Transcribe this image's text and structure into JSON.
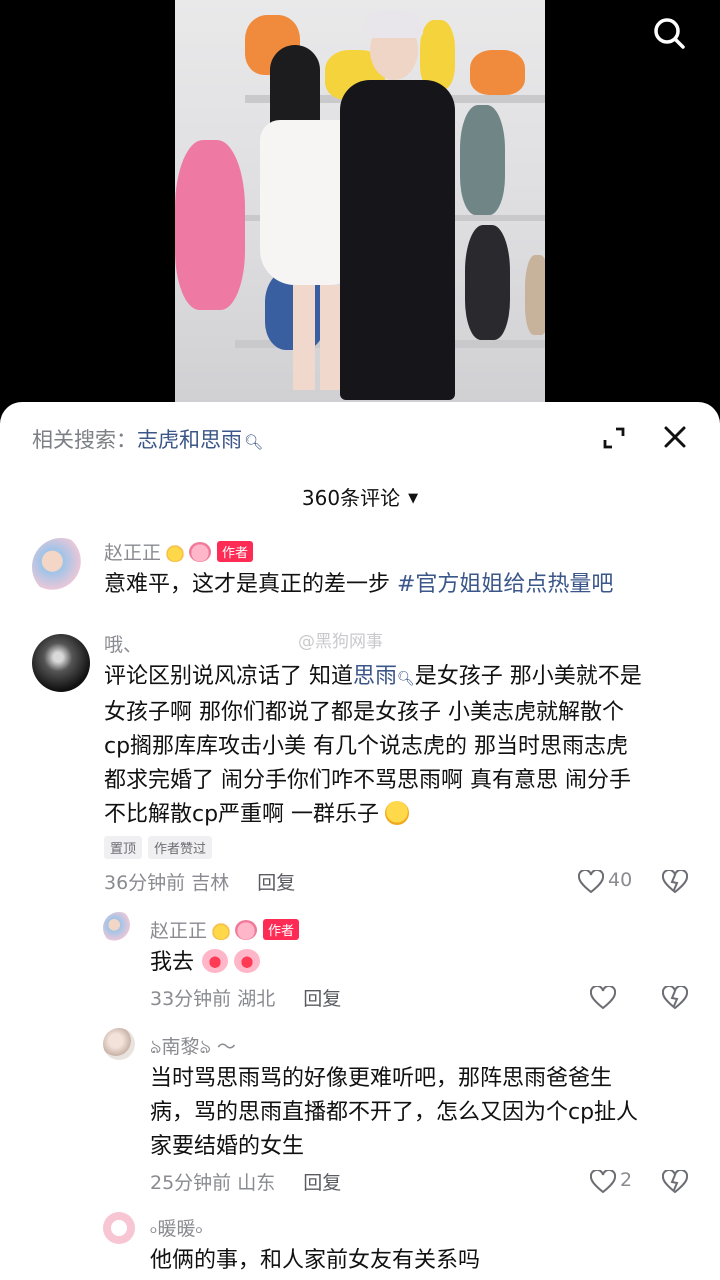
{
  "related_search": {
    "prefix": "相关搜索：",
    "term": "志虎和思雨"
  },
  "comments_count": "360条评论",
  "watermark": "@黑狗网事",
  "comments": [
    {
      "user": "赵正正",
      "badge": "作者",
      "text_a": "意难平，这才是真正的差一步 ",
      "hashtag": "#官方姐姐给点热量吧"
    },
    {
      "user": "哦、",
      "text_prefix": "评论区别说风凉话了 知道",
      "link": "思雨",
      "text_rest1": "是女孩子 那小美就不是",
      "line2": "女孩子啊 那你们都说了都是女孩子 小美志虎就解散个",
      "line3": "cp搁那库库攻击小美 有几个说志虎的 那当时思雨志虎",
      "line4": "都求完婚了 闹分手你们咋不骂思雨啊 真有意思 闹分手",
      "line5": "不比解散cp严重啊 一群乐子",
      "tags": [
        "置顶",
        "作者赞过"
      ],
      "time": "36分钟前 吉林",
      "reply": "回复",
      "likes": "40"
    },
    {
      "user": "赵正正",
      "badge": "作者",
      "text": "我去",
      "time": "33分钟前 湖北",
      "reply": "回复"
    },
    {
      "user": "ঌ南黎ঌ ～",
      "line1": "当时骂思雨骂的好像更难听吧，那阵思雨爸爸生",
      "line2": "病，骂的思雨直播都不开了，怎么又因为个cp扯人",
      "line3": "家要结婚的女生",
      "time": "25分钟前 山东",
      "reply": "回复",
      "likes": "2"
    },
    {
      "user": "৹暖暖৹",
      "text": "他俩的事，和人家前女友有关系吗"
    }
  ],
  "colors": {
    "accent": "#fe2c55",
    "link": "#3b5688",
    "muted": "#8a8b91"
  }
}
